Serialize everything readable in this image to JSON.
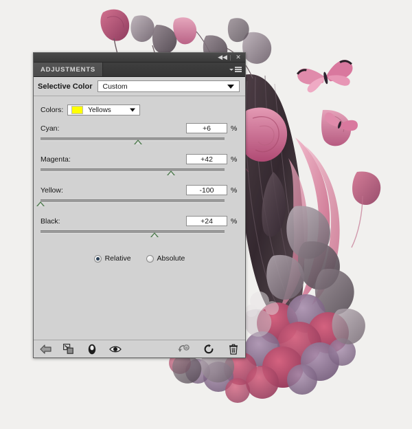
{
  "window": {
    "collapse_label": "◀◀",
    "close_label": "✕",
    "panel_menu_icon": "panel-menu-icon"
  },
  "panel": {
    "tab_label": "ADJUSTMENTS",
    "adjustment_title": "Selective Color",
    "preset": {
      "value": "Custom",
      "caret_icon": "chevron-down-icon"
    }
  },
  "colors": {
    "label": "Colors:",
    "value": "Yellows",
    "swatch_color": "#ffff00",
    "caret_icon": "chevron-down-icon"
  },
  "sliders": [
    {
      "label": "Cyan:",
      "value": "+6",
      "unit": "%",
      "percent": 53
    },
    {
      "label": "Magenta:",
      "value": "+42",
      "unit": "%",
      "percent": 71
    },
    {
      "label": "Yellow:",
      "value": "-100",
      "unit": "%",
      "percent": 0
    },
    {
      "label": "Black:",
      "value": "+24",
      "unit": "%",
      "percent": 62
    }
  ],
  "method": {
    "relative_label": "Relative",
    "absolute_label": "Absolute",
    "selected": "Relative"
  },
  "footer": {
    "left_icons": [
      "return-to-adjustment-list-icon",
      "clip-to-layer-icon",
      "toggle-layer-mask-icon",
      "toggle-layer-visibility-icon"
    ],
    "right_icons": [
      "reset-previous-state-icon",
      "reset-adjustment-icon",
      "delete-adjustment-layer-icon"
    ]
  },
  "theme": {
    "panel_background": "#d2d2d2",
    "titlebar_background": "#3a3a3a",
    "tab_background": "#4b4b4b",
    "slider_thumb": "#4f7c4f",
    "radio_dot": "#2a3f55",
    "canvas_background": "#f1f0ee"
  }
}
